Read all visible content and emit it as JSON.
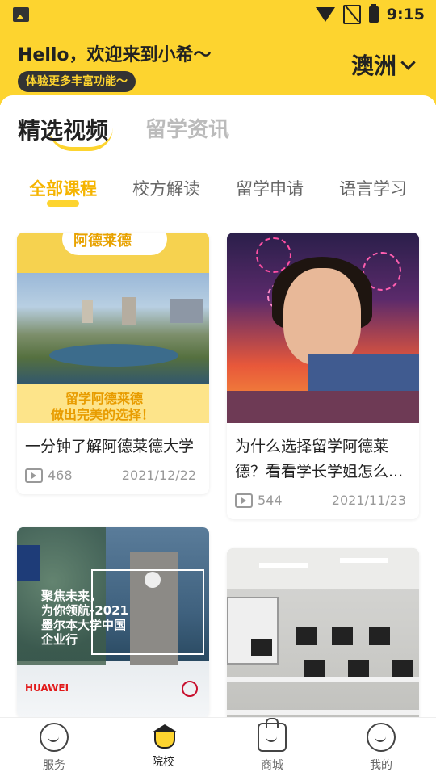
{
  "status": {
    "time": "9:15"
  },
  "header": {
    "greeting": "Hello，欢迎来到小希～",
    "badge": "体验更多丰富功能～",
    "region": "澳洲"
  },
  "main_tabs": [
    "精选视频",
    "留学资讯"
  ],
  "sub_tabs": [
    "全部课程",
    "校方解读",
    "留学申请",
    "语言学习"
  ],
  "cards": [
    {
      "title": "一分钟了解阿德莱德大学",
      "views": "468",
      "date": "2021/12/22",
      "thumb_top_text": "阿德莱德",
      "thumb_bottom_line1": "留学阿德莱德",
      "thumb_bottom_line2": "做出完美的选择！"
    },
    {
      "title": "为什么选择留学阿德莱德？看看学长学姐怎么...",
      "views": "544",
      "date": "2021/11/23"
    },
    {
      "title": "",
      "thumb_text": "聚焦未来，\n为你领航-2021\n墨尔本大学中国\n企业行",
      "logo_text": "HUAWEI"
    },
    {
      "title": ""
    }
  ],
  "tabbar": [
    {
      "label": "服务",
      "icon": "service-face-icon"
    },
    {
      "label": "院校",
      "icon": "school-cap-icon"
    },
    {
      "label": "商城",
      "icon": "shop-bag-icon"
    },
    {
      "label": "我的",
      "icon": "profile-face-icon"
    }
  ],
  "colors": {
    "accent": "#FDD42F",
    "active_text": "#F5B400"
  }
}
